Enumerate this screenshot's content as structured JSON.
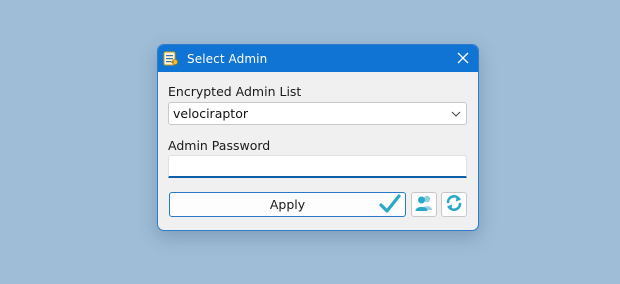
{
  "window": {
    "title": "Select Admin",
    "app_icon": "key-icon",
    "close_icon": "close-icon"
  },
  "admin_list": {
    "label": "Encrypted Admin List",
    "selected": "velociraptor",
    "arrow_icon": "chevron-down-icon"
  },
  "password": {
    "label": "Admin Password",
    "value": ""
  },
  "actions": {
    "apply_label": "Apply",
    "apply_icon": "checkmark-icon",
    "users_icon": "users-icon",
    "refresh_icon": "refresh-icon"
  },
  "colors": {
    "background": "#9fbdd6",
    "titlebar": "#0f74d3",
    "dialog": "#f0f0f0",
    "accent": "#2a78c8",
    "icon_teal": "#2aa7c9"
  }
}
